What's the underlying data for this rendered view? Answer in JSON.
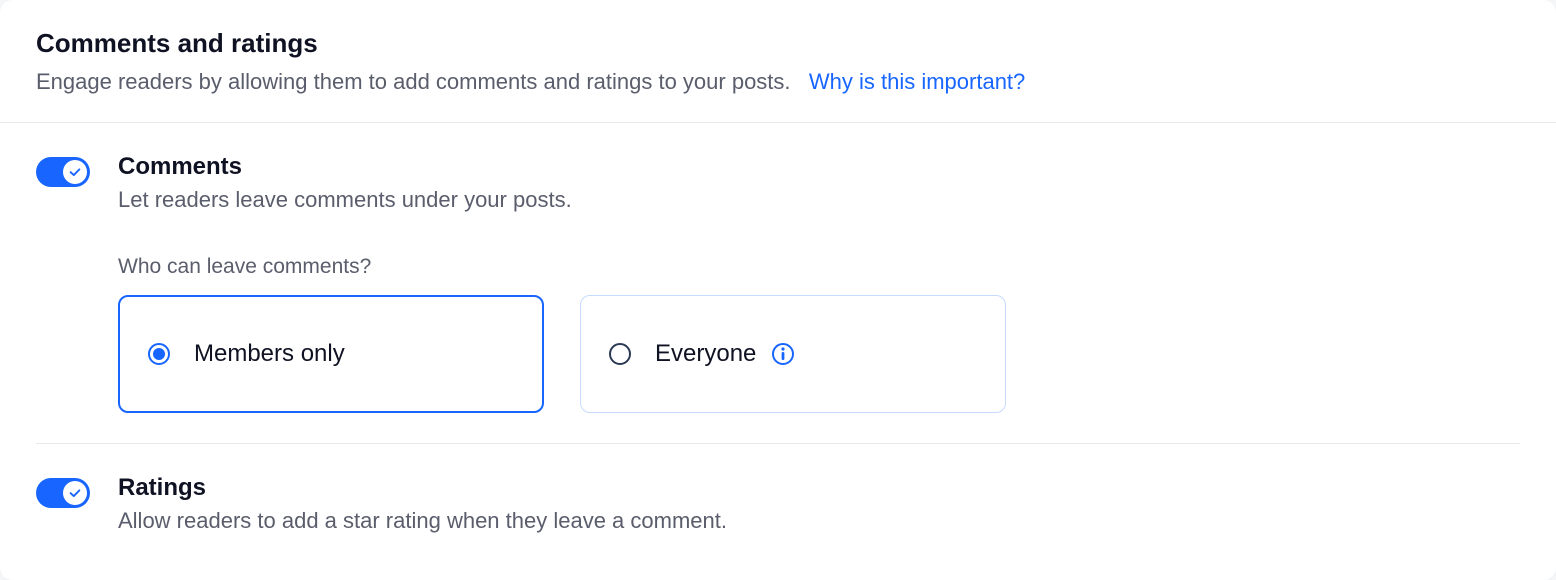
{
  "header": {
    "title": "Comments and ratings",
    "subtitle": "Engage readers by allowing them to add comments and ratings to your posts.",
    "help_link": "Why is this important?"
  },
  "comments": {
    "title": "Comments",
    "desc": "Let readers leave comments under your posts.",
    "who_label": "Who can leave comments?",
    "options": {
      "members": "Members only",
      "everyone": "Everyone"
    }
  },
  "ratings": {
    "title": "Ratings",
    "desc": "Allow readers to add a star rating when they leave a comment."
  }
}
